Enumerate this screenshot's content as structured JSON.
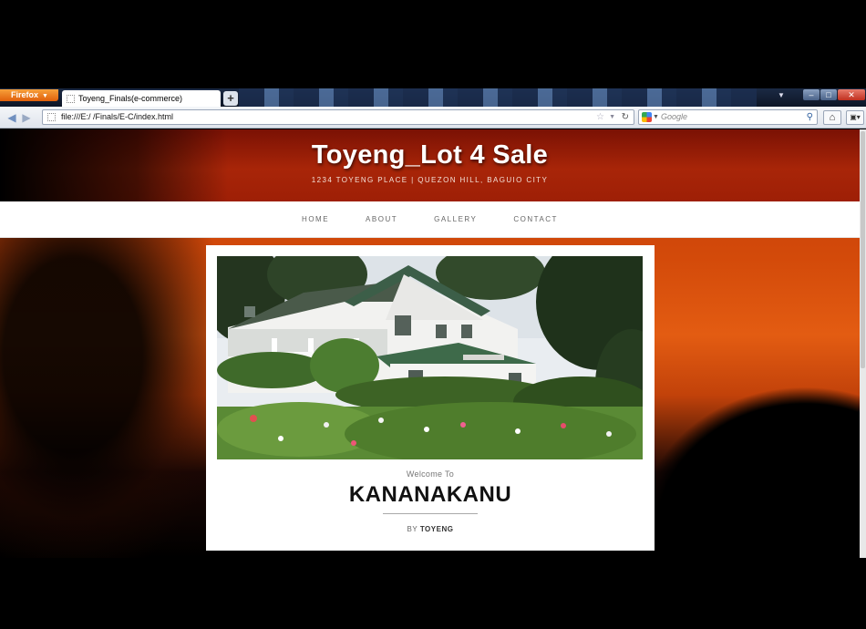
{
  "browser": {
    "menu_button": "Firefox",
    "tab_title": "Toyeng_Finals(e-commerce)",
    "new_tab": "+",
    "url": "file:///E:/ /Finals/E-C/index.html",
    "search_placeholder": "Google"
  },
  "site": {
    "title": "Toyeng_Lot 4 Sale",
    "subtitle": "1234 TOYENG PLACE | QUEZON HILL, BAGUIO CITY",
    "nav": [
      "HOME",
      "ABOUT",
      "GALLERY",
      "CONTACT"
    ]
  },
  "feature": {
    "welcome": "Welcome To",
    "headline": "KANANAKANU",
    "by_label": "BY",
    "author": "TOYENG"
  },
  "icons": [
    "page-icon",
    "back-icon",
    "forward-icon",
    "bookmark-star-icon",
    "reload-icon",
    "google-icon",
    "search-icon",
    "home-icon",
    "addon-bar-icon",
    "minimize-icon",
    "maximize-icon",
    "close-icon"
  ]
}
